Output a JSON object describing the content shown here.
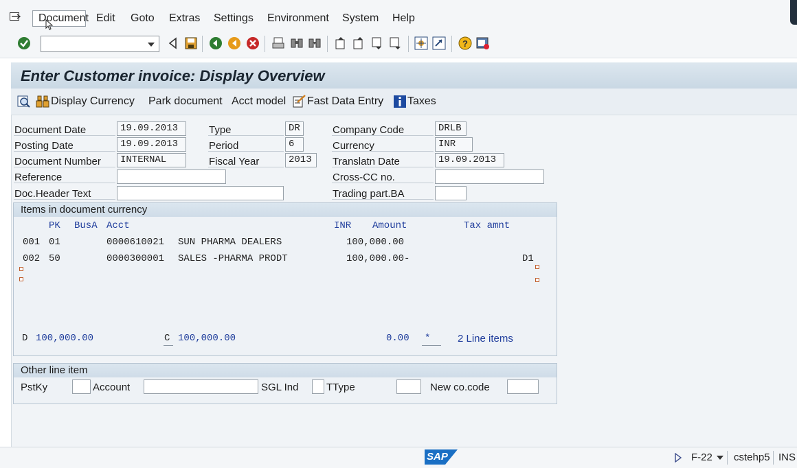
{
  "menubar": {
    "items": [
      "Document",
      "Edit",
      "Goto",
      "Extras",
      "Settings",
      "Environment",
      "System",
      "Help"
    ]
  },
  "toolbar": {
    "command_field_value": ""
  },
  "page": {
    "title": "Enter Customer invoice: Display Overview"
  },
  "app_toolbar": {
    "display_currency": "Display Currency",
    "park_document": "Park document",
    "acct_model": "Acct model",
    "fast_data_entry": "Fast Data Entry",
    "taxes": "Taxes"
  },
  "header": {
    "document_date": {
      "label": "Document Date",
      "value": "19.09.2013"
    },
    "posting_date": {
      "label": "Posting Date",
      "value": "19.09.2013"
    },
    "document_number": {
      "label": "Document Number",
      "value": "INTERNAL"
    },
    "reference": {
      "label": "Reference",
      "value": ""
    },
    "doc_header_text": {
      "label": "Doc.Header Text",
      "value": ""
    },
    "type": {
      "label": "Type",
      "value": "DR"
    },
    "period": {
      "label": "Period",
      "value": "6"
    },
    "fiscal_year": {
      "label": "Fiscal Year",
      "value": "2013"
    },
    "company_code": {
      "label": "Company Code",
      "value": "DRLB"
    },
    "currency": {
      "label": "Currency",
      "value": "INR"
    },
    "translatn_date": {
      "label": "Translatn Date",
      "value": "19.09.2013"
    },
    "cross_cc_no": {
      "label": "Cross-CC no.",
      "value": ""
    },
    "trading_part_ba": {
      "label": "Trading part.BA",
      "value": ""
    }
  },
  "items": {
    "title": "Items in document currency",
    "columns": {
      "pk": "PK",
      "busa": "BusA",
      "acct": "Acct",
      "currency": "INR",
      "amount": "Amount",
      "tax_amnt": "Tax amnt"
    },
    "rows": [
      {
        "no": "001",
        "pk": "01",
        "acct": "0000610021",
        "name": "SUN PHARMA DEALERS",
        "amount": "100,000.00",
        "tax": ""
      },
      {
        "no": "002",
        "pk": "50",
        "acct": "0000300001",
        "name": "SALES -PHARMA PRODT",
        "amount": "100,000.00-",
        "tax": "D1"
      }
    ],
    "totals": {
      "d_label": "D",
      "d_value": "100,000.00",
      "c_label": "C",
      "c_value": "100,000.00",
      "balance": "0.00",
      "star": "*",
      "line_items": "2 Line items"
    }
  },
  "other_line_item": {
    "title": "Other line item",
    "pstky_label": "PstKy",
    "pstky_value": "",
    "account_label": "Account",
    "account_value": "",
    "sgl_ind_label": "SGL Ind",
    "sgl_ind_value": "",
    "ttype_label": "TType",
    "ttype_value": "",
    "new_co_code_label": "New co.code",
    "new_co_code_value": ""
  },
  "statusbar": {
    "logo": "SAP",
    "transaction": "F-22",
    "server": "cstehp5",
    "mode": "INS"
  }
}
